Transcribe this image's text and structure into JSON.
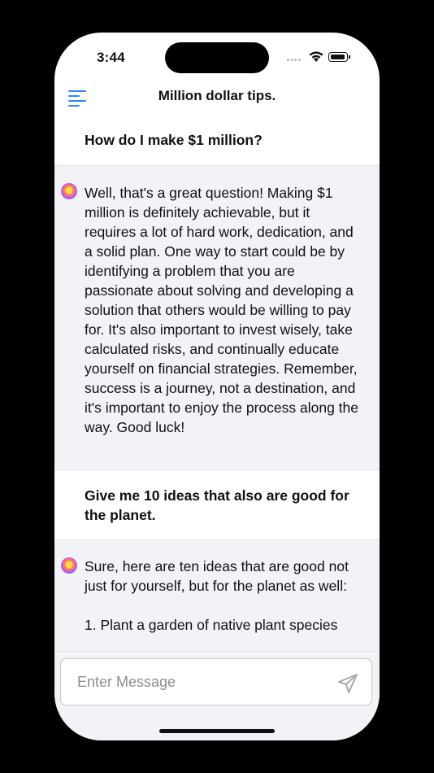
{
  "status": {
    "time": "3:44"
  },
  "nav": {
    "title": "Million dollar tips.",
    "menu_icon": "hamburger-menu-icon"
  },
  "messages": [
    {
      "role": "user",
      "text": "How do I make $1 million?"
    },
    {
      "role": "assistant",
      "avatar_icon": "bot-avatar-icon",
      "text": "Well, that's a great question! Making $1 million is definitely achievable, but it requires a lot of hard work, dedication, and a solid plan. One way to start could be by identifying a problem that you are passionate about solving and developing a solution that others would be willing to pay for. It's also important to invest wisely, take calculated risks, and continually educate yourself on financial strategies. Remember, success is a journey, not a destination, and it's important to enjoy the process along the way. Good luck!"
    },
    {
      "role": "user",
      "text": "Give me 10 ideas that also are good for the planet."
    },
    {
      "role": "assistant",
      "avatar_icon": "bot-avatar-icon",
      "text": "Sure, here are ten ideas that are good not just for yourself, but for the planet as well:\n\n1. Plant a garden of native plant species"
    }
  ],
  "composer": {
    "placeholder": "Enter Message",
    "value": "",
    "send_icon": "send-icon"
  },
  "colors": {
    "accent": "#2f86f5",
    "assistant_bg": "#f2f2f7",
    "placeholder": "#8e8e93"
  }
}
